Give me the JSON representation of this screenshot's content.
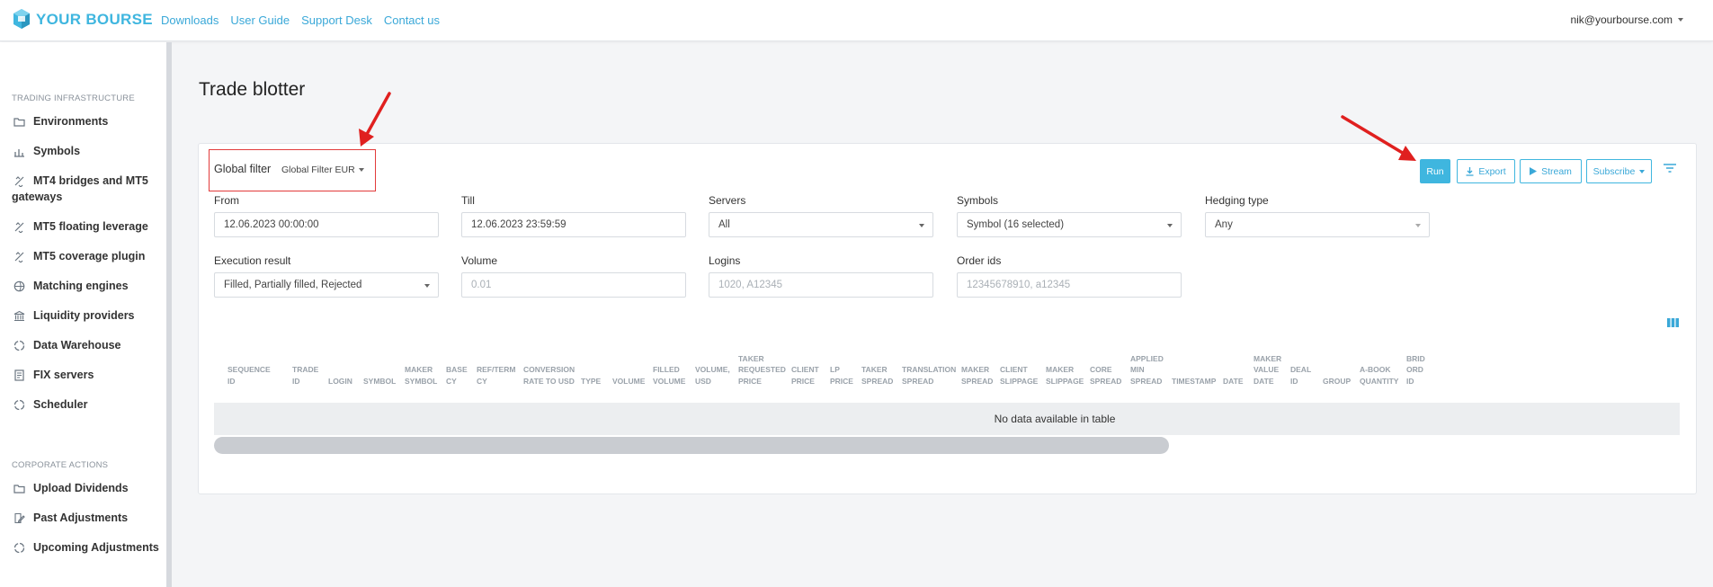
{
  "brand": {
    "name": "YOUR BOURSE",
    "color": "#3fb6df"
  },
  "topnav": [
    "Downloads",
    "User Guide",
    "Support Desk",
    "Contact us"
  ],
  "user": {
    "email": "nik@yourbourse.com"
  },
  "sidebar": {
    "sections": [
      {
        "title": "TRADING INFRASTRUCTURE",
        "items": [
          {
            "label": "Environments",
            "icon": "folder-icon"
          },
          {
            "label": "Symbols",
            "icon": "bar-chart-icon"
          },
          {
            "label": "MT4 bridges and MT5",
            "label2": "gateways",
            "icon": "link-icon"
          },
          {
            "label": "MT5 floating leverage",
            "icon": "link-icon"
          },
          {
            "label": "MT5 coverage plugin",
            "icon": "link-icon"
          },
          {
            "label": "Matching engines",
            "icon": "globe-icon"
          },
          {
            "label": "Liquidity providers",
            "icon": "bank-icon"
          },
          {
            "label": "Data Warehouse",
            "icon": "circle-icon"
          },
          {
            "label": "FIX servers",
            "icon": "server-icon"
          },
          {
            "label": "Scheduler",
            "icon": "circle-icon"
          }
        ]
      },
      {
        "title": "CORPORATE ACTIONS",
        "items": [
          {
            "label": "Upload Dividends",
            "icon": "folder-icon"
          },
          {
            "label": "Past Adjustments",
            "icon": "edit-icon"
          },
          {
            "label": "Upcoming Adjustments",
            "icon": "circle-icon"
          }
        ]
      }
    ]
  },
  "page": {
    "title": "Trade blotter"
  },
  "global_filter": {
    "label": "Global filter",
    "value": "Global Filter EUR"
  },
  "actions": {
    "run": "Run",
    "export": "Export",
    "stream": "Stream",
    "subscribe": "Subscribe"
  },
  "filters": {
    "from": {
      "label": "From",
      "value": "12.06.2023 00:00:00"
    },
    "till": {
      "label": "Till",
      "value": "12.06.2023 23:59:59"
    },
    "servers": {
      "label": "Servers",
      "value": "All"
    },
    "symbols": {
      "label": "Symbols",
      "value": "Symbol (16 selected)"
    },
    "hedging": {
      "label": "Hedging type",
      "value": "Any"
    },
    "execution": {
      "label": "Execution result",
      "value": "Filled, Partially filled, Rejected"
    },
    "volume": {
      "label": "Volume",
      "placeholder": "0.01"
    },
    "logins": {
      "label": "Logins",
      "placeholder": "1020, A12345"
    },
    "orderids": {
      "label": "Order ids",
      "placeholder": "12345678910, a12345"
    }
  },
  "table": {
    "columns": [
      "SEQUENCE|ID",
      "TRADE|ID",
      "LOGIN",
      "SYMBOL",
      "MAKER|SYMBOL",
      "BASE|CY",
      "REF/TERM|CY",
      "CONVERSION|RATE TO USD",
      "TYPE",
      "VOLUME",
      "FILLED|VOLUME",
      "VOLUME,|USD",
      "TAKER|REQUESTED|PRICE",
      "CLIENT|PRICE",
      "LP|PRICE",
      "TAKER|SPREAD",
      "TRANSLATION|SPREAD",
      "MAKER|SPREAD",
      "CLIENT|SLIPPAGE",
      "MAKER|SLIPPAGE",
      "CORE|SPREAD",
      "APPLIED|MIN|SPREAD",
      "TIMESTAMP",
      "DATE",
      "MAKER|VALUE|DATE",
      "DEAL|ID",
      "GROUP",
      "A-BOOK|QUANTITY",
      "BRID|ORD|ID"
    ],
    "empty_message": "No data available in table"
  }
}
